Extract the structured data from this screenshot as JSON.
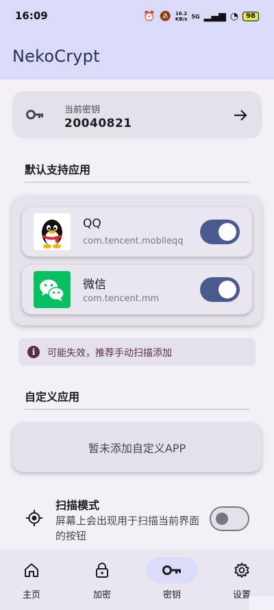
{
  "status_bar": {
    "time": "16:09",
    "net_speed_value": "16.2",
    "net_speed_unit": "KB/s",
    "network": "5G",
    "battery": "98"
  },
  "app_bar": {
    "title": "NekoCrypt"
  },
  "current_key": {
    "label": "当前密钥",
    "value": "20040821",
    "key_icon": "key-icon",
    "action_icon": "arrow-right-icon"
  },
  "default_apps": {
    "title": "默认支持应用",
    "items": [
      {
        "name": "QQ",
        "package": "com.tencent.mobileqq",
        "enabled": true,
        "icon": "qq-logo"
      },
      {
        "name": "微信",
        "package": "com.tencent.mm",
        "enabled": true,
        "icon": "wechat-logo"
      }
    ],
    "warning": "可能失效，推荐手动扫描添加",
    "warning_icon": "info-icon"
  },
  "custom_apps": {
    "title": "自定义应用",
    "empty_text": "暂未添加自定义APP"
  },
  "scan_mode": {
    "title": "扫描模式",
    "description": "屏幕上会出现用于扫描当前界面的按钮",
    "enabled": false,
    "icon": "crosshair-icon"
  },
  "bottom_nav": {
    "items": [
      {
        "label": "主页",
        "icon": "home-icon",
        "active": false
      },
      {
        "label": "加密",
        "icon": "lock-icon",
        "active": false
      },
      {
        "label": "密钥",
        "icon": "key-icon",
        "active": true
      },
      {
        "label": "设置",
        "icon": "gear-icon",
        "active": false
      }
    ]
  },
  "colors": {
    "accent": "#4a5a8f",
    "app_bar": "#d9dbf8",
    "warning_text": "#5b2e4a"
  }
}
